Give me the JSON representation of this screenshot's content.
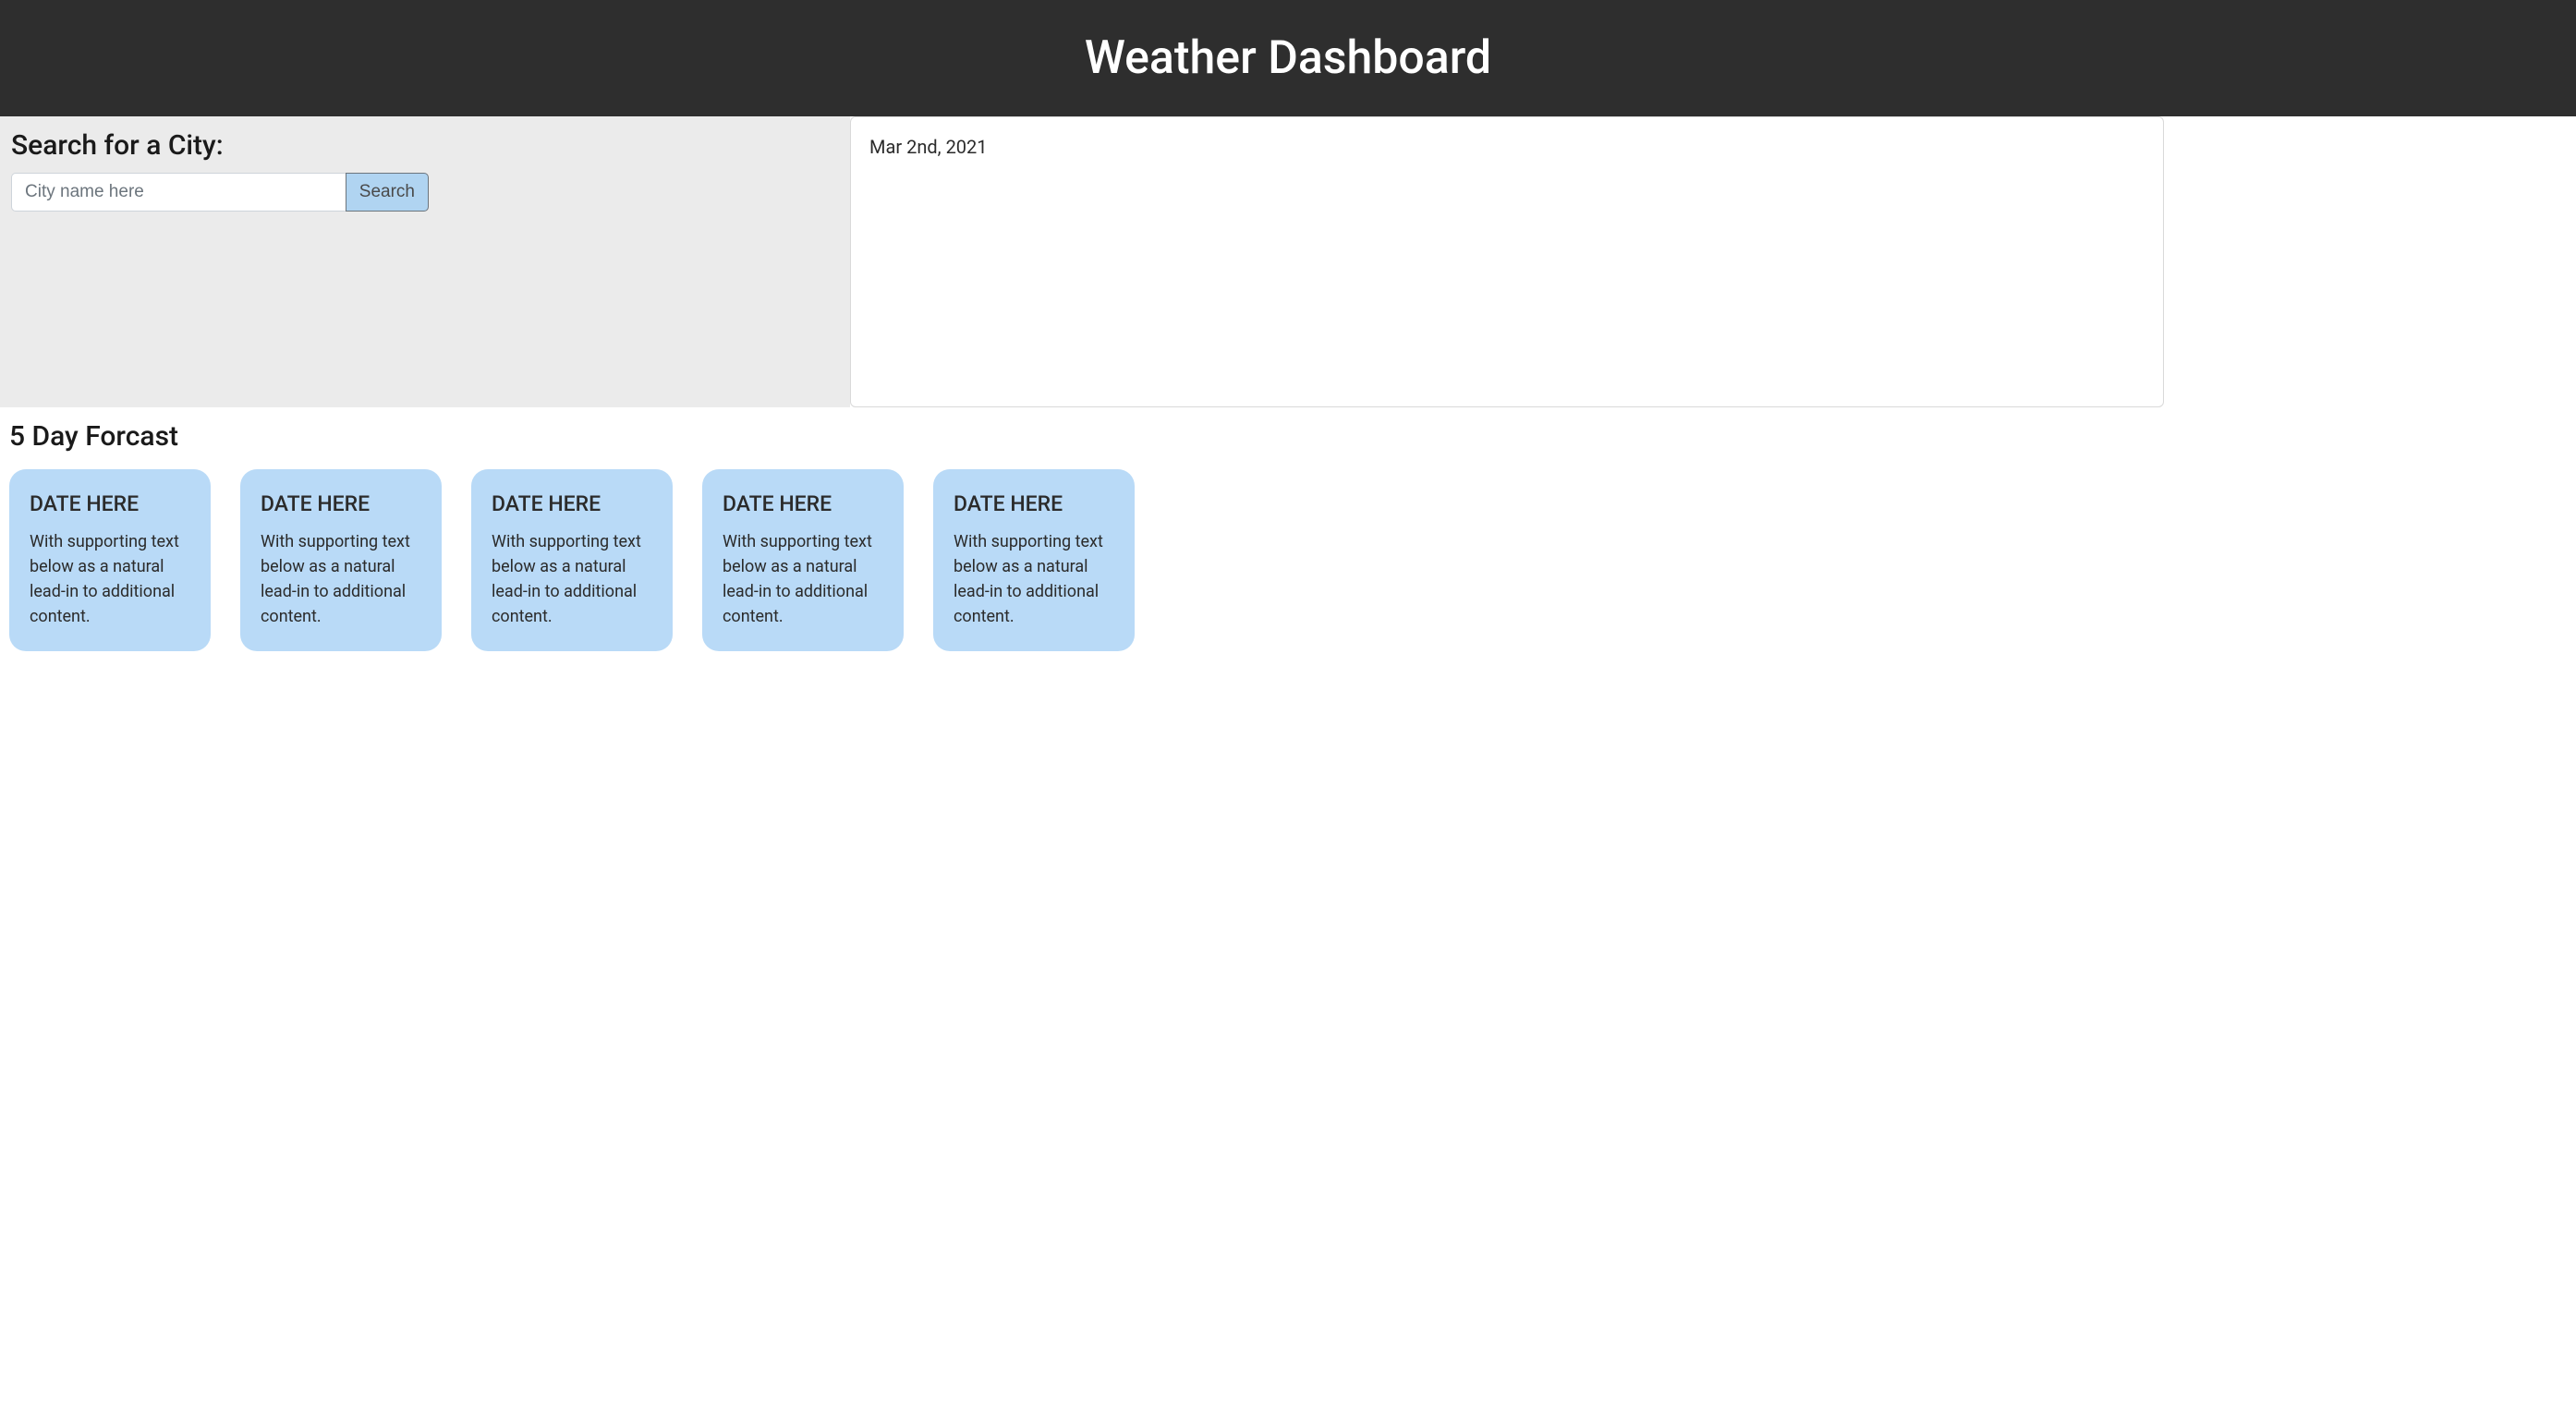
{
  "header": {
    "title": "Weather Dashboard"
  },
  "search": {
    "heading": "Search for a City:",
    "placeholder": "City name here",
    "button_label": "Search"
  },
  "current": {
    "date_text": "Mar 2nd, 2021"
  },
  "forecast": {
    "heading": "5 Day Forcast",
    "cards": [
      {
        "title": "DATE HERE",
        "body": "With supporting text below as a natural lead-in to additional content."
      },
      {
        "title": "DATE HERE",
        "body": "With supporting text below as a natural lead-in to additional content."
      },
      {
        "title": "DATE HERE",
        "body": "With supporting text below as a natural lead-in to additional content."
      },
      {
        "title": "DATE HERE",
        "body": "With supporting text below as a natural lead-in to additional content."
      },
      {
        "title": "DATE HERE",
        "body": "With supporting text below as a natural lead-in to additional content."
      }
    ]
  }
}
